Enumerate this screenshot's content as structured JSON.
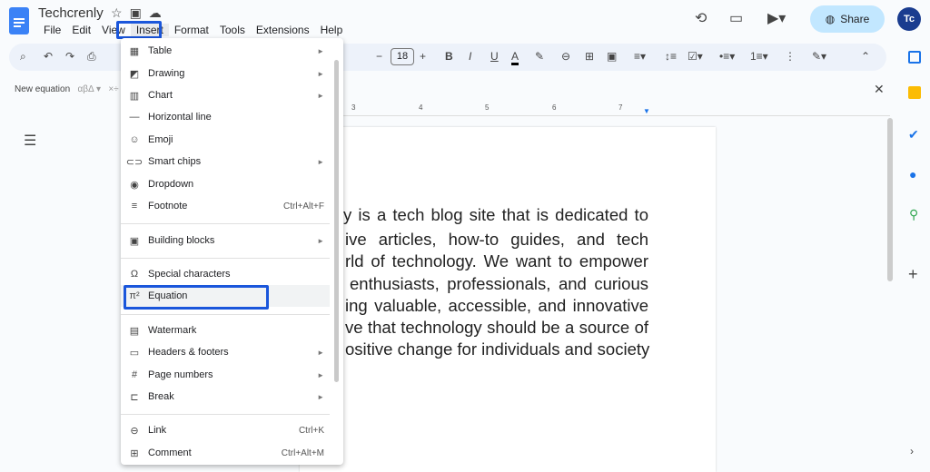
{
  "app": {
    "title": "Techcrenly",
    "share_label": "Share",
    "avatar": "Tc"
  },
  "menubar": [
    "File",
    "Edit",
    "View",
    "Insert",
    "Format",
    "Tools",
    "Extensions",
    "Help"
  ],
  "toolbar": {
    "font_size": "18"
  },
  "equation_bar": {
    "new_equation": "New equation",
    "greek": "αβΔ ▾",
    "ops": "×÷"
  },
  "ruler": [
    "3",
    "4",
    "5",
    "6",
    "7"
  ],
  "insert_menu": [
    {
      "icon": "table-icon",
      "glyph": "▦",
      "label": "Table",
      "submenu": true
    },
    {
      "icon": "drawing-icon",
      "glyph": "◩",
      "label": "Drawing",
      "submenu": true
    },
    {
      "icon": "chart-icon",
      "glyph": "▥",
      "label": "Chart",
      "submenu": true
    },
    {
      "icon": "horizontal-line-icon",
      "glyph": "—",
      "label": "Horizontal line"
    },
    {
      "icon": "emoji-icon",
      "glyph": "☺",
      "label": "Emoji"
    },
    {
      "icon": "smart-chips-icon",
      "glyph": "⊂⊃",
      "label": "Smart chips",
      "submenu": true
    },
    {
      "icon": "dropdown-icon",
      "glyph": "◉",
      "label": "Dropdown"
    },
    {
      "icon": "footnote-icon",
      "glyph": "≡",
      "label": "Footnote",
      "shortcut": "Ctrl+Alt+F"
    },
    {
      "icon": "building-blocks-icon",
      "glyph": "▣",
      "label": "Building blocks",
      "submenu": true
    },
    {
      "icon": "special-characters-icon",
      "glyph": "Ω",
      "label": "Special characters"
    },
    {
      "icon": "equation-icon",
      "glyph": "π²",
      "label": "Equation",
      "highlighted": true
    },
    {
      "icon": "watermark-icon",
      "glyph": "▤",
      "label": "Watermark"
    },
    {
      "icon": "headers-footers-icon",
      "glyph": "▭",
      "label": "Headers & footers",
      "submenu": true
    },
    {
      "icon": "page-numbers-icon",
      "glyph": "#",
      "label": "Page numbers",
      "submenu": true
    },
    {
      "icon": "break-icon",
      "glyph": "⊏",
      "label": "Break",
      "submenu": true
    },
    {
      "icon": "link-icon",
      "glyph": "⊖",
      "label": "Link",
      "shortcut": "Ctrl+K"
    },
    {
      "icon": "comment-icon",
      "glyph": "⊞",
      "label": "Comment",
      "shortcut": "Ctrl+Alt+M"
    }
  ],
  "document_lines": [
    "y is a tech blog site that is dedicated to",
    "ive articles, how-to guides, and tech",
    "rld of technology. We want to empower",
    "enthusiasts, professionals, and curious",
    "ing valuable, accessible, and innovative",
    "ve that technology should be a source of",
    "ositive change for individuals and society"
  ],
  "colors": {
    "accent": "#1a56db",
    "share_bg": "#c2e7ff",
    "toolbar_bg": "#edf2fa"
  }
}
